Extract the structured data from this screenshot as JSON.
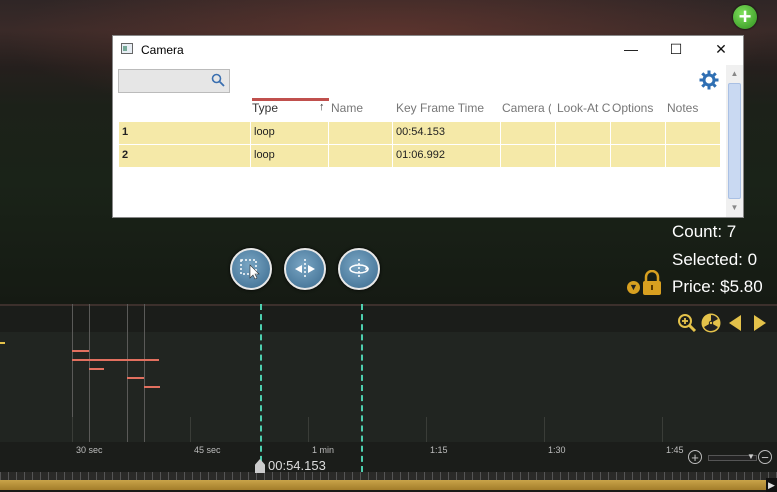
{
  "window": {
    "title": "Camera",
    "minimize": "—",
    "maximize": "☐",
    "close": "✕"
  },
  "search": {
    "placeholder": "",
    "icon": "search-icon"
  },
  "settings": {
    "icon": "gear-icon"
  },
  "table": {
    "columns": [
      "Type",
      "Name",
      "Key Frame Time",
      "Camera (",
      "Look-At C",
      "Options",
      "Notes"
    ],
    "sort_column": "Type",
    "sort_indicator": "↑",
    "rows": [
      {
        "id": "1",
        "type": "loop",
        "name": "",
        "keyframe": "00:54.153",
        "camera": "",
        "lookat": "",
        "options": "",
        "notes": ""
      },
      {
        "id": "2",
        "type": "loop",
        "name": "",
        "keyframe": "01:06.992",
        "camera": "",
        "lookat": "",
        "options": "",
        "notes": ""
      }
    ]
  },
  "stats": {
    "count": "Count: 7",
    "selected": "Selected: 0",
    "price": "Price: $5.80"
  },
  "timeline": {
    "labels": [
      "30 sec",
      "45 sec",
      "1 min",
      "1:15",
      "1:30",
      "1:45"
    ],
    "cursor_time": "00:54.153"
  },
  "colors": {
    "row_highlight": "#f5e9a8",
    "sort_underline": "#c0504d",
    "accent_blue": "#2f6fb3",
    "scrubber_gold": "#c9a449",
    "cursor_teal": "#4ed0b0"
  }
}
